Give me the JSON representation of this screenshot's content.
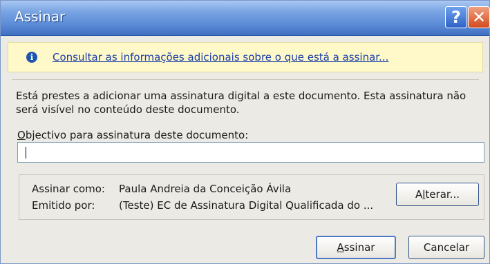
{
  "window": {
    "title": "Assinar",
    "help_glyph": "?",
    "close_glyph": "✕"
  },
  "info": {
    "icon": "info-icon",
    "icon_glyph": "i",
    "link_text": "Consultar as informações adicionais sobre o que está a assinar..."
  },
  "description": "Está prestes a adicionar uma assinatura digital a este documento. Esta assinatura não será visível no conteúdo deste documento.",
  "purpose": {
    "label_first": "O",
    "label_rest": "bjectivo para assinatura deste documento:",
    "value": ""
  },
  "signer": {
    "sign_as_label": "Assinar como:",
    "sign_as_value": "Paula Andreia da Conceição Ávila",
    "issued_by_label": "Emitido por:",
    "issued_by_value": "(Teste) EC de Assinatura Digital Qualificada do ...",
    "change_first": "A",
    "change_mid": "l",
    "change_rest": "terar..."
  },
  "buttons": {
    "sign_first": "A",
    "sign_rest": "ssinar",
    "cancel": "Cancelar"
  },
  "colors": {
    "titlebar": "#5b8bd6",
    "infobar": "#fff8c9",
    "link": "#1a3fa8",
    "dialog": "#eceae4"
  }
}
